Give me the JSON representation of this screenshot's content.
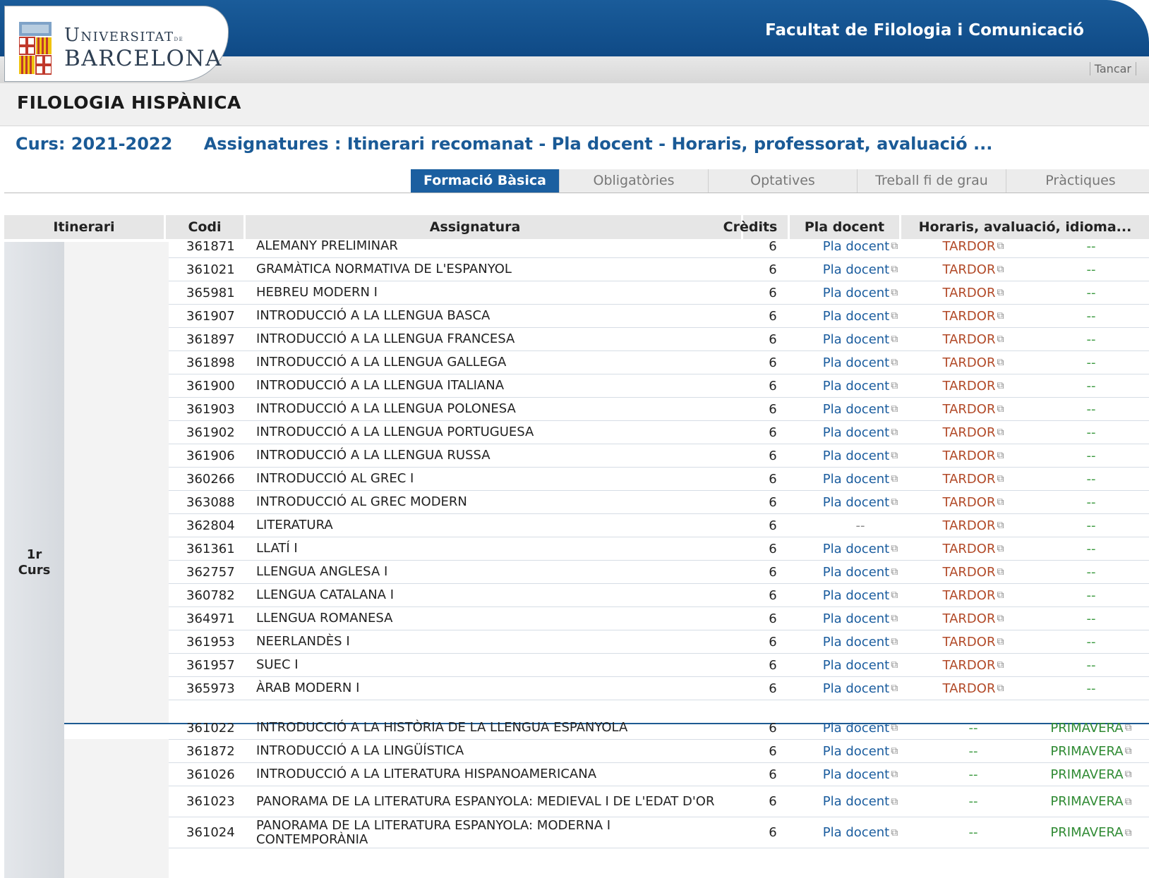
{
  "header": {
    "logo_line1": "Universitat",
    "logo_line1_de": "de",
    "logo_line2": "BARCELONA",
    "faculty": "Facultat de Filologia i Comunicació",
    "close_label": "Tancar"
  },
  "page": {
    "title": "FILOLOGIA HISPÀNICA",
    "course": "Curs: 2021-2022",
    "subject_line": "Assignatures : Itinerari recomanat - Pla docent - Horaris, professorat, avaluació ..."
  },
  "tabs": [
    {
      "label": "Formació Bàsica",
      "active": true
    },
    {
      "label": "Obligatòries",
      "active": false
    },
    {
      "label": "Optatives",
      "active": false
    },
    {
      "label": "Treball fi de grau",
      "active": false
    },
    {
      "label": "Pràctiques",
      "active": false
    }
  ],
  "table": {
    "headers": {
      "itinerari": "Itinerari",
      "codi": "Codi",
      "assignatura": "Assignatura",
      "credits": "Crèdits",
      "pla_docent": "Pla docent",
      "horaris": "Horaris, avaluació, idioma..."
    },
    "curs_label_line1": "1r",
    "curs_label_line2": "Curs",
    "rows": [
      {
        "code": "361871",
        "name": "ALEMANY PRELIMINAR",
        "credits": "6",
        "pla": "Pla docent",
        "autumn": "TARDOR",
        "spring": "--"
      },
      {
        "code": "361021",
        "name": "GRAMÀTICA NORMATIVA DE L'ESPANYOL",
        "credits": "6",
        "pla": "Pla docent",
        "autumn": "TARDOR",
        "spring": "--"
      },
      {
        "code": "365981",
        "name": "HEBREU MODERN I",
        "credits": "6",
        "pla": "Pla docent",
        "autumn": "TARDOR",
        "spring": "--"
      },
      {
        "code": "361907",
        "name": "INTRODUCCIÓ A LA LLENGUA BASCA",
        "credits": "6",
        "pla": "Pla docent",
        "autumn": "TARDOR",
        "spring": "--"
      },
      {
        "code": "361897",
        "name": "INTRODUCCIÓ A LA LLENGUA FRANCESA",
        "credits": "6",
        "pla": "Pla docent",
        "autumn": "TARDOR",
        "spring": "--"
      },
      {
        "code": "361898",
        "name": "INTRODUCCIÓ A LA LLENGUA GALLEGA",
        "credits": "6",
        "pla": "Pla docent",
        "autumn": "TARDOR",
        "spring": "--"
      },
      {
        "code": "361900",
        "name": "INTRODUCCIÓ A LA LLENGUA ITALIANA",
        "credits": "6",
        "pla": "Pla docent",
        "autumn": "TARDOR",
        "spring": "--"
      },
      {
        "code": "361903",
        "name": "INTRODUCCIÓ A LA LLENGUA POLONESA",
        "credits": "6",
        "pla": "Pla docent",
        "autumn": "TARDOR",
        "spring": "--"
      },
      {
        "code": "361902",
        "name": "INTRODUCCIÓ A LA LLENGUA PORTUGUESA",
        "credits": "6",
        "pla": "Pla docent",
        "autumn": "TARDOR",
        "spring": "--"
      },
      {
        "code": "361906",
        "name": "INTRODUCCIÓ A LA LLENGUA RUSSA",
        "credits": "6",
        "pla": "Pla docent",
        "autumn": "TARDOR",
        "spring": "--"
      },
      {
        "code": "360266",
        "name": "INTRODUCCIÓ AL GREC I",
        "credits": "6",
        "pla": "Pla docent",
        "autumn": "TARDOR",
        "spring": "--"
      },
      {
        "code": "363088",
        "name": "INTRODUCCIÓ AL GREC MODERN",
        "credits": "6",
        "pla": "Pla docent",
        "autumn": "TARDOR",
        "spring": "--"
      },
      {
        "code": "362804",
        "name": "LITERATURA",
        "credits": "6",
        "pla": "--",
        "autumn": "TARDOR",
        "spring": "--"
      },
      {
        "code": "361361",
        "name": "LLATÍ I",
        "credits": "6",
        "pla": "Pla docent",
        "autumn": "TARDOR",
        "spring": "--"
      },
      {
        "code": "362757",
        "name": "LLENGUA ANGLESA I",
        "credits": "6",
        "pla": "Pla docent",
        "autumn": "TARDOR",
        "spring": "--"
      },
      {
        "code": "360782",
        "name": "LLENGUA CATALANA I",
        "credits": "6",
        "pla": "Pla docent",
        "autumn": "TARDOR",
        "spring": "--"
      },
      {
        "code": "364971",
        "name": "LLENGUA ROMANESA",
        "credits": "6",
        "pla": "Pla docent",
        "autumn": "TARDOR",
        "spring": "--"
      },
      {
        "code": "361953",
        "name": "NEERLANDÈS I",
        "credits": "6",
        "pla": "Pla docent",
        "autumn": "TARDOR",
        "spring": "--"
      },
      {
        "code": "361957",
        "name": "SUEC I",
        "credits": "6",
        "pla": "Pla docent",
        "autumn": "TARDOR",
        "spring": "--"
      },
      {
        "code": "365973",
        "name": "ÀRAB MODERN I",
        "credits": "6",
        "pla": "Pla docent",
        "autumn": "TARDOR",
        "spring": "--"
      },
      {
        "code": "361022",
        "name": "INTRODUCCIÓ A LA HISTÒRIA DE LA LLENGUA ESPANYOLA",
        "credits": "6",
        "pla": "Pla docent",
        "autumn": "--",
        "spring": "PRIMAVERA"
      },
      {
        "code": "361872",
        "name": "INTRODUCCIÓ A LA LINGÜÍSTICA",
        "credits": "6",
        "pla": "Pla docent",
        "autumn": "--",
        "spring": "PRIMAVERA"
      },
      {
        "code": "361026",
        "name": "INTRODUCCIÓ A LA LITERATURA HISPANOAMERICANA",
        "credits": "6",
        "pla": "Pla docent",
        "autumn": "--",
        "spring": "PRIMAVERA"
      },
      {
        "code": "361023",
        "name": "PANORAMA DE LA LITERATURA ESPANYOLA: MEDIEVAL I DE L'EDAT D'OR",
        "credits": "6",
        "pla": "Pla docent",
        "autumn": "--",
        "spring": "PRIMAVERA"
      },
      {
        "code": "361024",
        "name": "PANORAMA DE LA LITERATURA ESPANYOLA: MODERNA I CONTEMPORÀNIA",
        "credits": "6",
        "pla": "Pla docent",
        "autumn": "--",
        "spring": "PRIMAVERA"
      }
    ]
  },
  "colors": {
    "brand_blue": "#1a5c9a",
    "autumn": "#b24a28",
    "spring": "#2f8a33",
    "link": "#1a5c9e"
  },
  "icons": {
    "external": "external-link-icon",
    "shield": "university-shield-icon"
  }
}
